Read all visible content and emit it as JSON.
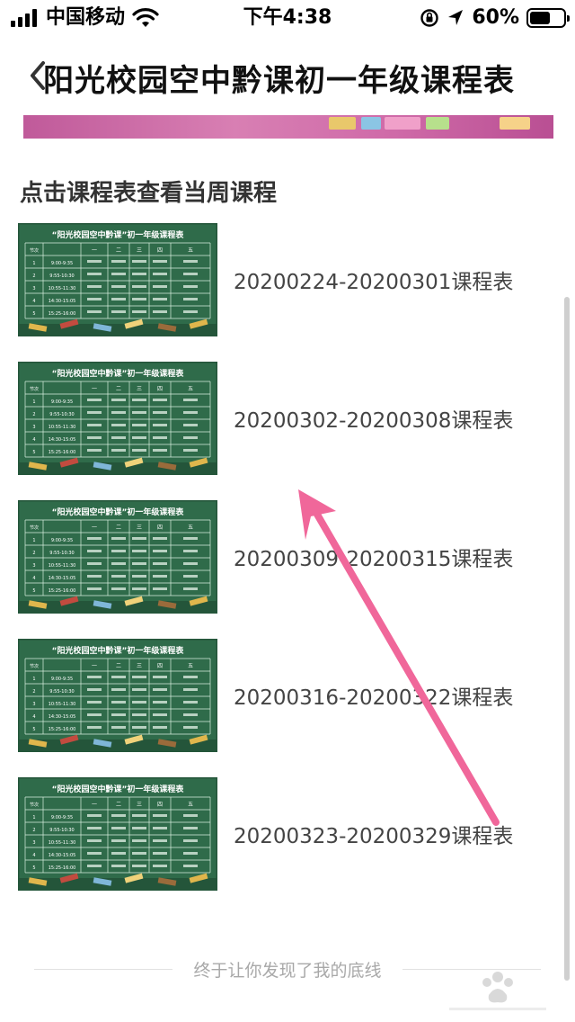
{
  "status_bar": {
    "carrier": "中国移动",
    "time": "下午4:38",
    "battery_percent": "60%",
    "battery_level": 0.6
  },
  "nav": {
    "title": "阳光校园空中黔课初一年级课程表"
  },
  "section_title": "点击课程表查看当周课程",
  "schedules": [
    {
      "label": "20200224-20200301课程表"
    },
    {
      "label": "20200302-20200308课程表"
    },
    {
      "label": "20200309-20200315课程表"
    },
    {
      "label": "20200316-20200322课程表"
    },
    {
      "label": "20200323-20200329课程表"
    }
  ],
  "thumbnail": {
    "title": "“阳光校园空中黔课”初一年级课程表",
    "header": [
      "节次",
      "一",
      "二",
      "三",
      "四",
      "五"
    ],
    "times": [
      "9:00-9:35",
      "9:55-10:30",
      "10:55-11:30",
      "14:30-15:05",
      "15:25-16:00"
    ]
  },
  "footer": {
    "text": "终于让你发现了我的底线"
  },
  "colors": {
    "chalkboard": "#2f6b4a",
    "chalkboard_dark": "#24553a",
    "arrow": "#f0679a",
    "banner": "#c862a2"
  }
}
